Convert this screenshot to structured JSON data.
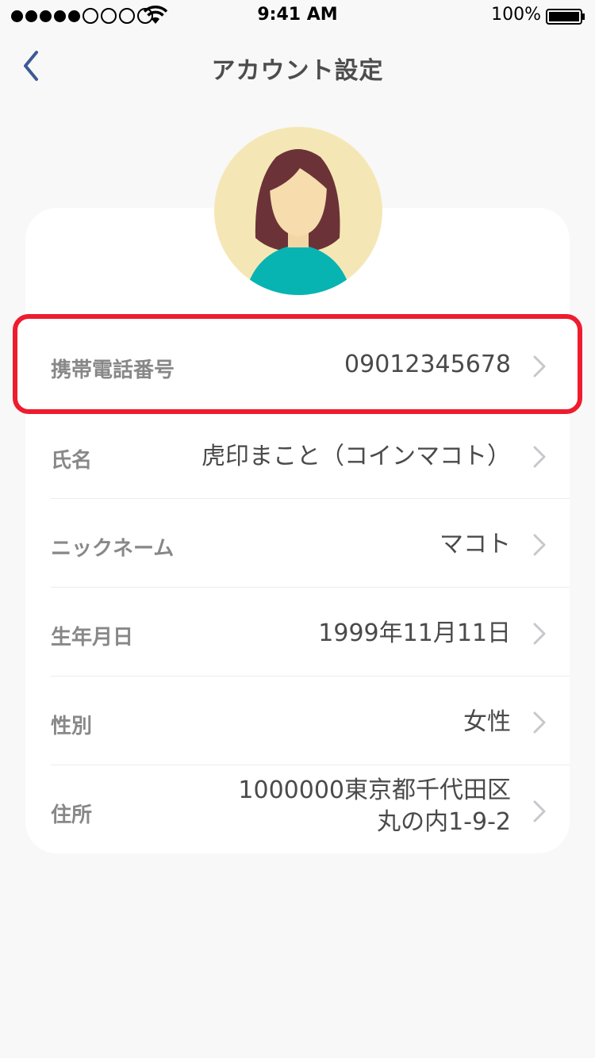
{
  "status_bar": {
    "time": "9:41 AM",
    "battery": "100%"
  },
  "nav": {
    "title": "アカウント設定"
  },
  "rows": [
    {
      "label": "携帯電話番号",
      "value": "09012345678"
    },
    {
      "label": "氏名",
      "value": "虎印まこと（コインマコト）"
    },
    {
      "label": "ニックネーム",
      "value": "マコト"
    },
    {
      "label": "生年月日",
      "value": "1999年11月11日"
    },
    {
      "label": "性別",
      "value": "女性"
    },
    {
      "label": "住所",
      "value_line1": "1000000東京都千代田区",
      "value_line2": "丸の内1-9-2"
    }
  ],
  "colors": {
    "highlight": "#ee1c2e",
    "back_arrow": "#3d5a96",
    "avatar_bg": "#f5e7b5",
    "hair": "#6b3338",
    "shirt": "#07b4b2"
  },
  "icons": [
    "back-chevron-icon",
    "chevron-right-icon",
    "wifi-icon",
    "battery-icon"
  ]
}
